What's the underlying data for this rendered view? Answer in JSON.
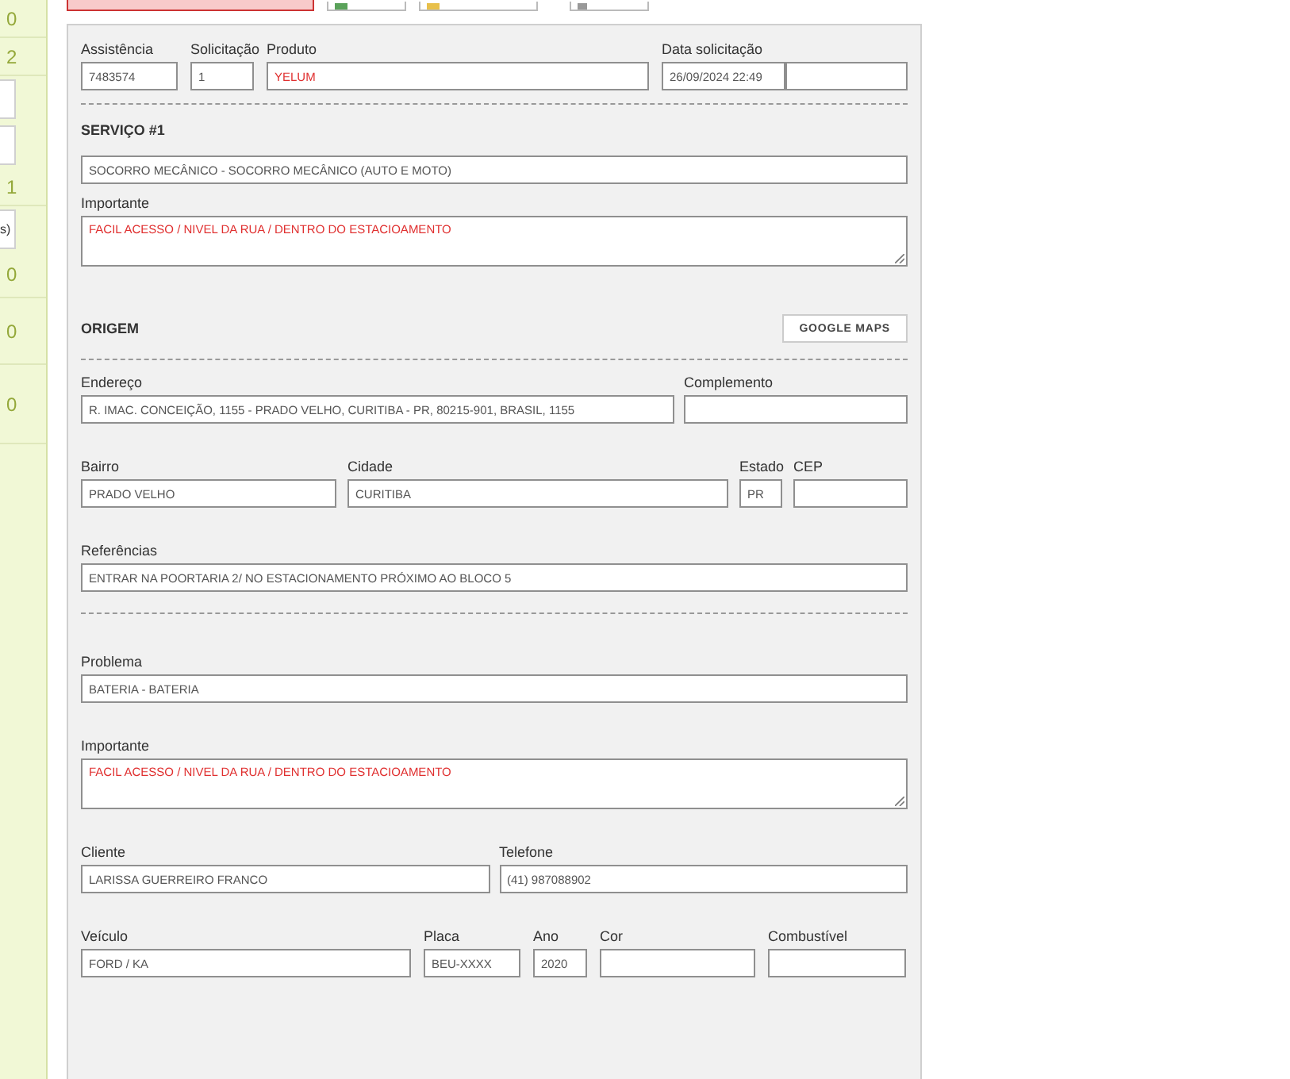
{
  "sidebar": {
    "items": [
      {
        "kind": "count",
        "count": "0"
      },
      {
        "kind": "count",
        "count": "2"
      },
      {
        "kind": "field"
      },
      {
        "kind": "field"
      },
      {
        "kind": "count",
        "count": "1"
      },
      {
        "kind": "field",
        "value": "s)"
      },
      {
        "kind": "count",
        "count": "0"
      },
      {
        "kind": "count",
        "count": "0"
      },
      {
        "kind": "count",
        "count": "0"
      }
    ]
  },
  "form": {
    "rows": [
      {
        "kind": "fields",
        "fields": [
          {
            "kind": "input",
            "label": "Assistência",
            "value": "7483574",
            "alert": false
          },
          {
            "kind": "input",
            "label": "Solicitação",
            "value": "1",
            "alert": false
          },
          {
            "kind": "input",
            "label": "Produto",
            "value": "YELUM",
            "alert": true
          },
          {
            "kind": "datetime",
            "label": "Data solicitação",
            "value": "26/09/2024 22:49",
            "alert": false
          }
        ]
      },
      {
        "kind": "divider"
      },
      {
        "kind": "heading",
        "title": "SERVIÇO #1"
      },
      {
        "kind": "fields",
        "fields": [
          {
            "kind": "input",
            "value": "SOCORRO MECÂNICO - SOCORRO MECÂNICO (AUTO E MOTO)",
            "alert": false
          }
        ]
      },
      {
        "kind": "fields",
        "fields": [
          {
            "kind": "textarea",
            "label": "Importante",
            "value": "FACIL ACESSO / NIVEL DA RUA / DENTRO DO ESTACIOAMENTO",
            "alert": true
          }
        ]
      },
      {
        "kind": "heading",
        "title": "ORIGEM",
        "button": "GOOGLE MAPS"
      },
      {
        "kind": "divider"
      },
      {
        "kind": "fields",
        "fields": [
          {
            "kind": "input",
            "label": "Endereço",
            "value": "R. IMAC. CONCEIÇÃO, 1155 - PRADO VELHO, CURITIBA - PR, 80215-901, BRASIL, 1155",
            "alert": false
          },
          {
            "kind": "input",
            "label": "Complemento"
          }
        ]
      },
      {
        "kind": "fields",
        "fields": [
          {
            "kind": "input",
            "label": "Bairro",
            "value": "PRADO VELHO",
            "alert": false
          },
          {
            "kind": "input",
            "label": "Cidade",
            "value": "CURITIBA",
            "alert": false
          },
          {
            "kind": "input",
            "label": "Estado",
            "value": "PR",
            "alert": false
          },
          {
            "kind": "input",
            "label": "CEP"
          }
        ]
      },
      {
        "kind": "fields",
        "fields": [
          {
            "kind": "input",
            "label": "Referências",
            "value": "ENTRAR NA POORTARIA 2/ NO ESTACIONAMENTO PRÓXIMO AO BLOCO 5",
            "alert": false
          }
        ]
      },
      {
        "kind": "divider"
      },
      {
        "kind": "fields",
        "fields": [
          {
            "kind": "input",
            "label": "Problema",
            "value": "BATERIA - BATERIA",
            "alert": false
          }
        ]
      },
      {
        "kind": "fields",
        "fields": [
          {
            "kind": "textarea",
            "label": "Importante",
            "value": "FACIL ACESSO / NIVEL DA RUA / DENTRO DO ESTACIOAMENTO",
            "alert": true
          }
        ]
      },
      {
        "kind": "fields",
        "fields": [
          {
            "kind": "input",
            "label": "Cliente",
            "value": "LARISSA GUERREIRO FRANCO",
            "alert": false
          },
          {
            "kind": "input",
            "label": "Telefone",
            "value": "(41) 987088902",
            "alert": false
          }
        ]
      },
      {
        "kind": "fields",
        "fields": [
          {
            "kind": "input",
            "label": "Veículo",
            "value": "FORD / KA",
            "alert": false
          },
          {
            "kind": "input",
            "label": "Placa",
            "value": "BEU-XXXX",
            "alert": false
          },
          {
            "kind": "input",
            "label": "Ano",
            "value": "2020",
            "alert": false
          },
          {
            "kind": "input",
            "label": "Cor"
          },
          {
            "kind": "input",
            "label": "Combustível"
          }
        ]
      }
    ]
  }
}
